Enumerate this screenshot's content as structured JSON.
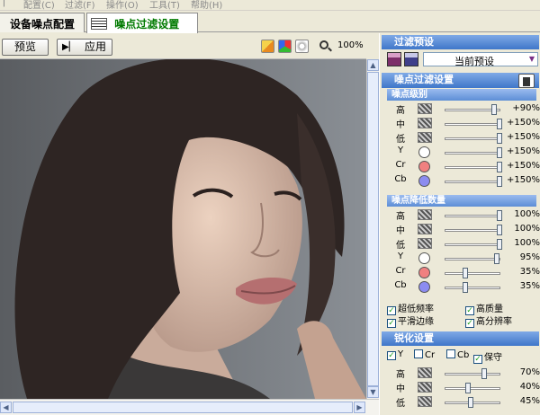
{
  "menu": [
    "配置(C)",
    "过滤(F)",
    "操作(O)",
    "工具(T)",
    "帮助(H)"
  ],
  "tabs": [
    {
      "label": "设备噪点配置"
    },
    {
      "label": "噪点过滤设置"
    }
  ],
  "toolbar": {
    "preview_label": "预览",
    "apply_label": "应用",
    "zoom_value": "100%"
  },
  "panel": {
    "filter_preset_title": "过滤预设",
    "preset_value": "当前预设",
    "noise_filter_title": "噪点过滤设置",
    "noise_level": {
      "title": "噪点级别",
      "rows": [
        {
          "label": "高",
          "value": "+90%",
          "fraction": 0.9
        },
        {
          "label": "中",
          "value": "+150%",
          "fraction": 1.0
        },
        {
          "label": "低",
          "value": "+150%",
          "fraction": 1.0
        },
        {
          "label": "Y",
          "value": "+150%",
          "fraction": 1.0,
          "dot": "#ffffff"
        },
        {
          "label": "Cr",
          "value": "+150%",
          "fraction": 1.0,
          "dot": "#f08080"
        },
        {
          "label": "Cb",
          "value": "+150%",
          "fraction": 1.0,
          "dot": "#8c8cf0"
        }
      ]
    },
    "noise_reduction": {
      "title": "噪点降低数量",
      "rows": [
        {
          "label": "高",
          "value": "100%",
          "fraction": 1.0
        },
        {
          "label": "中",
          "value": "100%",
          "fraction": 1.0
        },
        {
          "label": "低",
          "value": "100%",
          "fraction": 1.0
        },
        {
          "label": "Y",
          "value": "95%",
          "fraction": 0.95,
          "dot": "#ffffff"
        },
        {
          "label": "Cr",
          "value": "35%",
          "fraction": 0.35,
          "dot": "#f08080"
        },
        {
          "label": "Cb",
          "value": "35%",
          "fraction": 0.35,
          "dot": "#8c8cf0"
        }
      ]
    },
    "options": [
      {
        "label": "超低频率",
        "checked": true
      },
      {
        "label": "高质量",
        "checked": true
      },
      {
        "label": "平滑边缘",
        "checked": true
      },
      {
        "label": "高分辨率",
        "checked": true
      }
    ],
    "sharpen": {
      "title": "锐化设置",
      "channels": [
        {
          "label": "Y",
          "checked": true
        },
        {
          "label": "Cr",
          "checked": false
        },
        {
          "label": "Cb",
          "checked": false
        },
        {
          "label": "保守",
          "checked": true
        }
      ],
      "rows": [
        {
          "label": "高",
          "value": "70%",
          "fraction": 0.7
        },
        {
          "label": "中",
          "value": "40%",
          "fraction": 0.4
        },
        {
          "label": "低",
          "value": "45%",
          "fraction": 0.45
        }
      ]
    }
  },
  "icons": {
    "scroll_up": "▲",
    "scroll_down": "▼",
    "scroll_left": "◀",
    "scroll_right": "▶",
    "check": "✓",
    "dropdown": "▼",
    "play": "▶"
  },
  "colors": {
    "panel_header": "#3f76c9",
    "active_tab_text": "#007a00"
  }
}
